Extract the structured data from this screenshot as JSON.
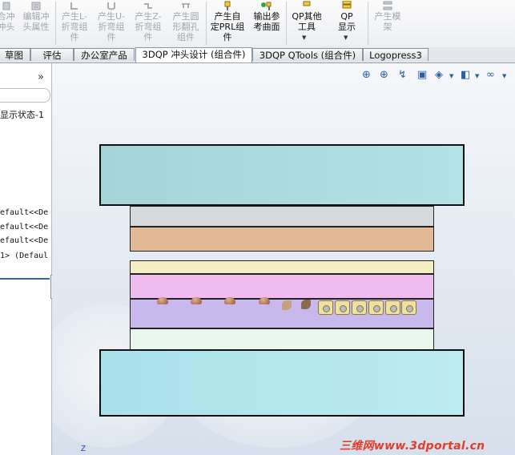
{
  "ribbon": {
    "buttons": [
      {
        "label": "合冲 冲头",
        "enabled": false
      },
      {
        "label": "编辑冲 头属性",
        "enabled": false
      },
      {
        "label": "产生L- 折弯组 件",
        "enabled": false
      },
      {
        "label": "产生U- 折弯组 件",
        "enabled": false
      },
      {
        "label": "产生Z- 折弯组 件",
        "enabled": false
      },
      {
        "label": "产生圆 形翻孔 组件",
        "enabled": false
      },
      {
        "label": "产生自 定PRL组 件",
        "enabled": true
      },
      {
        "label": "输出参 考曲面",
        "enabled": true
      },
      {
        "label": "QP其他 工具",
        "enabled": true
      },
      {
        "label": "QP 显示",
        "enabled": true
      },
      {
        "label": "产生模 架",
        "enabled": false
      }
    ]
  },
  "tabs": [
    {
      "label": "草图",
      "active": false
    },
    {
      "label": "评估",
      "active": false
    },
    {
      "label": "办公室产品",
      "active": false
    },
    {
      "label": "3DQP 冲头设计 (组合件)",
      "active": true
    },
    {
      "label": "3DQP QTools (组合件)",
      "active": false
    },
    {
      "label": "Logopress3",
      "active": false
    }
  ],
  "left_panel": {
    "collapse_label": "»",
    "display_state": "显示状态-1",
    "tree_items": [
      "efault<<De",
      "efault<<De",
      "efault<<De",
      "1> (Defaul"
    ]
  },
  "viewport": {
    "triad_label": "Z",
    "watermark": "三维网www.3dportal.cn",
    "colors": {
      "top_plate": "#a8d9dd",
      "stripper_grey": "#d6d8dc",
      "backing_plate": "#e3b896",
      "yellow_plate": "#f4efc2",
      "pink_plate": "#eebcef",
      "lavender_plate": "#c9b8ec",
      "mint_plate": "#e8f8ef",
      "bottom_plate": "#b2e6ee"
    }
  }
}
